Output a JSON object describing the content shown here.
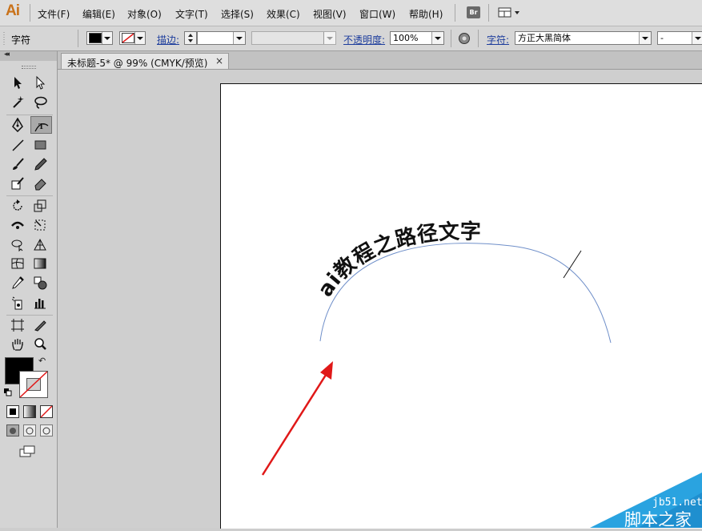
{
  "app": {
    "logo": "Ai"
  },
  "menu": [
    {
      "id": "file",
      "label": "文件(F)"
    },
    {
      "id": "edit",
      "label": "编辑(E)"
    },
    {
      "id": "object",
      "label": "对象(O)"
    },
    {
      "id": "type",
      "label": "文字(T)"
    },
    {
      "id": "select",
      "label": "选择(S)"
    },
    {
      "id": "effect",
      "label": "效果(C)"
    },
    {
      "id": "view",
      "label": "视图(V)"
    },
    {
      "id": "window",
      "label": "窗口(W)"
    },
    {
      "id": "help",
      "label": "帮助(H)"
    }
  ],
  "bridge_button": "Br",
  "control_bar": {
    "context_label": "字符",
    "stroke_label": "描边:",
    "stroke_weight": "",
    "style_value": "",
    "opacity_label": "不透明度:",
    "opacity_value": "100%",
    "character_label": "字符:",
    "font_family": "方正大黑简体",
    "font_style": "-"
  },
  "colors": {
    "fill": "#000000",
    "stroke": "none",
    "path_stroke": "#6f8fc9",
    "arrow": "#e01818",
    "watermark": "#2aa3e0"
  },
  "document": {
    "tab_title": "未标题-5* @ 99% (CMYK/预览)",
    "close_glyph": "×"
  },
  "artwork": {
    "path_text": "ai教程之路径文字"
  },
  "watermark": {
    "url": "jb51.net",
    "site_name": "脚本之家"
  }
}
